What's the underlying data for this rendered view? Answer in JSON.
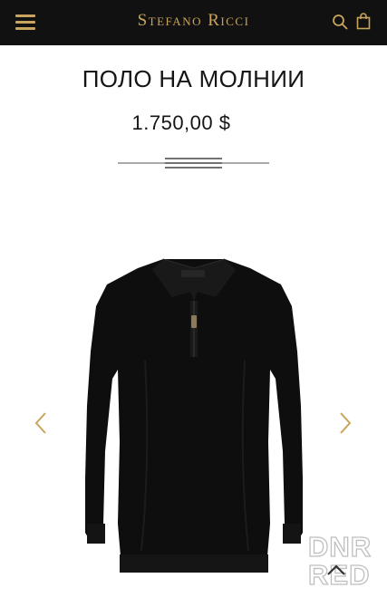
{
  "header": {
    "brand": "Stefano Ricci",
    "menu_icon": "hamburger-menu-icon",
    "search_icon": "search-icon",
    "bag_icon": "shopping-bag-icon",
    "accent_color": "#c9a45c",
    "background_color": "#111111"
  },
  "product": {
    "title": "ПОЛО НА МОЛНИИ",
    "price": "1.750,00 $",
    "image_icon": "black-zip-polo-sweater-image"
  },
  "gallery": {
    "prev_icon": "chevron-left-icon",
    "next_icon": "chevron-right-icon"
  },
  "footer": {
    "watermark_line1": "DNR",
    "watermark_line2": "RED",
    "scroll_top_icon": "chevron-up-icon"
  }
}
